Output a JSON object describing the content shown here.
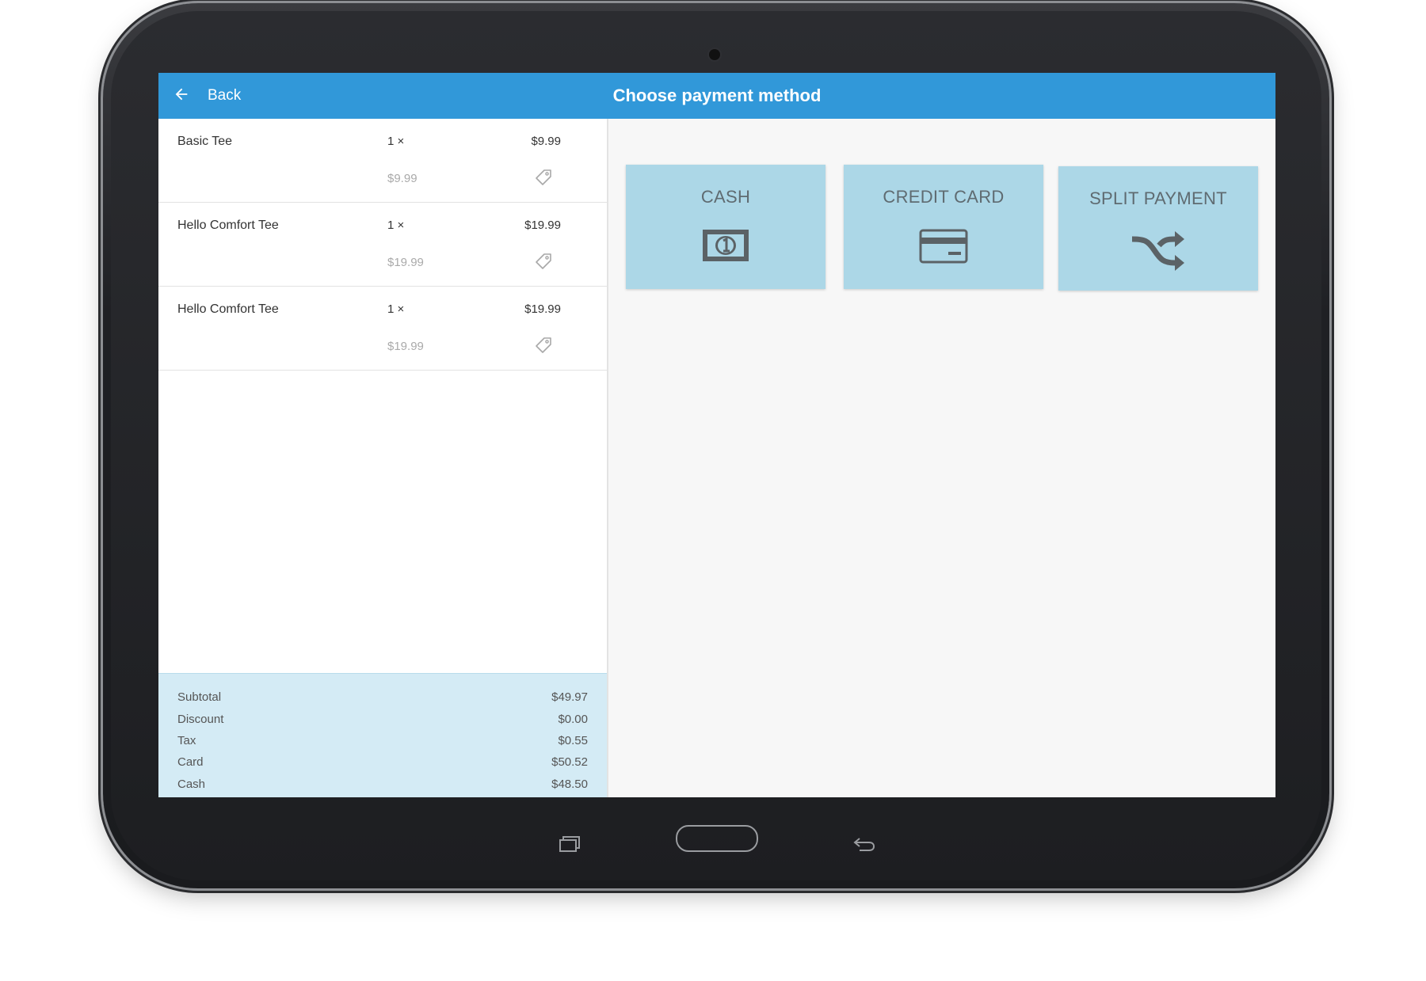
{
  "header": {
    "back_label": "Back",
    "title": "Choose payment method",
    "bar_color": "#3198d9"
  },
  "cart": {
    "items": [
      {
        "name": "Basic Tee",
        "qty": "1 ×",
        "price": "$9.99",
        "unit_price": "$9.99",
        "tag_icon": "price-tag-icon"
      },
      {
        "name": "Hello Comfort Tee",
        "qty": "1 ×",
        "price": "$19.99",
        "unit_price": "$19.99",
        "tag_icon": "price-tag-icon"
      },
      {
        "name": "Hello Comfort Tee",
        "qty": "1 ×",
        "price": "$19.99",
        "unit_price": "$19.99",
        "tag_icon": "price-tag-icon"
      }
    ]
  },
  "totals": {
    "subtotal_label": "Subtotal",
    "subtotal_value": "$49.97",
    "discount_label": "Discount",
    "discount_value": "$0.00",
    "tax_label": "Tax",
    "tax_value": "$0.55",
    "card_label": "Card",
    "card_value": "$50.52",
    "cash_label": "Cash",
    "cash_value": "$48.50",
    "background_color": "#d4ebf5"
  },
  "payment_methods": [
    {
      "label": "CASH",
      "icon": "cash-icon"
    },
    {
      "label": "CREDIT CARD",
      "icon": "credit-card-icon"
    },
    {
      "label": "SPLIT PAYMENT",
      "icon": "shuffle-icon"
    }
  ],
  "tile_color": "#acd7e7",
  "device_nav": {
    "recent_icon": "recent-apps-icon",
    "home_icon": "home-button-icon",
    "back_icon": "back-arrow-icon"
  }
}
